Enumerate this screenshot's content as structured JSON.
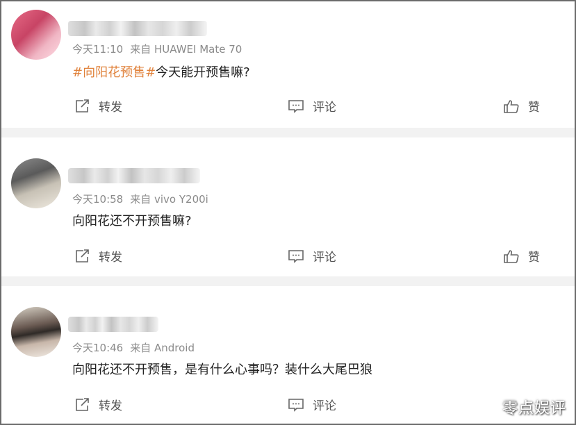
{
  "posts": [
    {
      "meta_time": "今天11:10",
      "meta_source": "来自 HUAWEI Mate 70",
      "topic": "#向阳花预售#",
      "text": "今天能开预售嘛?",
      "actions": {
        "repost": "转发",
        "comment": "评论",
        "like": "赞"
      }
    },
    {
      "meta_time": "今天10:58",
      "meta_source": "来自 vivo Y200i",
      "topic": "",
      "text": "向阳花还不开预售嘛?",
      "actions": {
        "repost": "转发",
        "comment": "评论",
        "like": "赞"
      }
    },
    {
      "meta_time": "今天10:46",
      "meta_source": "来自 Android",
      "topic": "",
      "text": "向阳花还不开预售，是有什么心事吗？装什么大尾巴狼",
      "actions": {
        "repost": "转发",
        "comment": "评论"
      }
    }
  ],
  "watermark": "零点娱评",
  "colors": {
    "topic": "#e0813a",
    "meta": "#8a8a8a",
    "separator": "#f2f2f2"
  }
}
